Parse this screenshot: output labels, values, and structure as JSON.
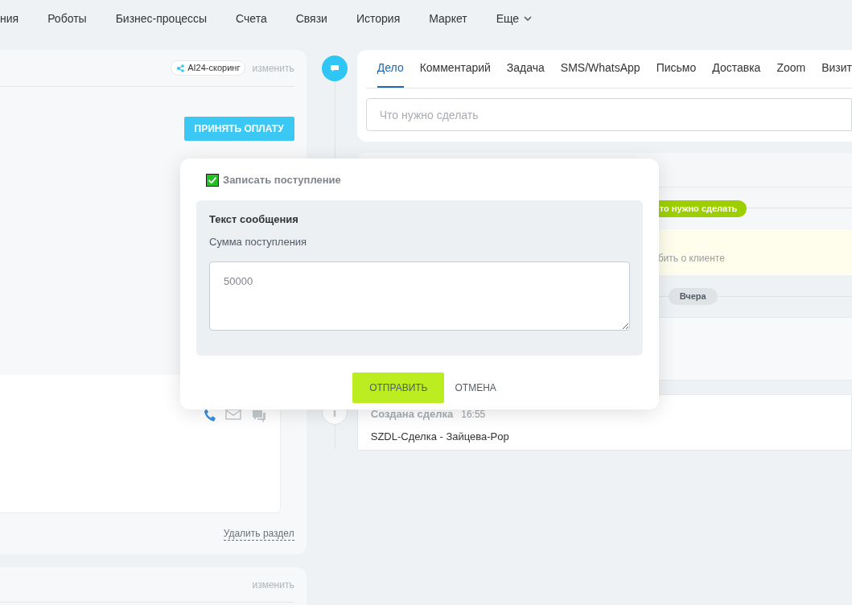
{
  "nav": {
    "items": [
      {
        "label": "ния",
        "dropdown": false
      },
      {
        "label": "Роботы",
        "dropdown": false
      },
      {
        "label": "Бизнес-процессы",
        "dropdown": false
      },
      {
        "label": "Счета",
        "dropdown": false
      },
      {
        "label": "Связи",
        "dropdown": false
      },
      {
        "label": "История",
        "dropdown": false
      },
      {
        "label": "Маркет",
        "dropdown": false
      },
      {
        "label": "Еще",
        "dropdown": true
      }
    ]
  },
  "left_panel": {
    "scoring_badge": "AI24-скоринг",
    "edit_link": "изменить",
    "pay_button": "ПРИНЯТЬ ОПЛАТУ",
    "delete_link": "Удалить раздел"
  },
  "left_panel_2": {
    "edit_link": "изменить"
  },
  "activity": {
    "tabs": [
      {
        "label": "Дело",
        "selected": true
      },
      {
        "label": "Комментарий",
        "selected": false
      },
      {
        "label": "Задача",
        "selected": false
      },
      {
        "label": "SMS/WhatsApp",
        "selected": false
      },
      {
        "label": "Письмо",
        "selected": false
      },
      {
        "label": "Доставка",
        "selected": false
      },
      {
        "label": "Zoom",
        "selected": false
      },
      {
        "label": "Визит",
        "selected": false
      }
    ],
    "placeholder": "Что нужно сделать"
  },
  "timeline": {
    "todo_pill": "то нужно сделать",
    "reminder_text": "бить о клиенте",
    "day_pill": "Вчера",
    "event": {
      "title": "Создана сделка",
      "time": "16:55",
      "text": "SZDL-Сделка - Зайцева-Pop"
    }
  },
  "modal": {
    "checkbox": {
      "label": "Записать поступление",
      "checked": true
    },
    "section_title": "Текст сообщения",
    "field_label": "Сумма поступления",
    "field_value": "50000",
    "buttons": [
      {
        "label": "ОТПРАВИТЬ",
        "kind": "primary"
      },
      {
        "label": "ОТМЕНА",
        "kind": "link"
      }
    ]
  }
}
